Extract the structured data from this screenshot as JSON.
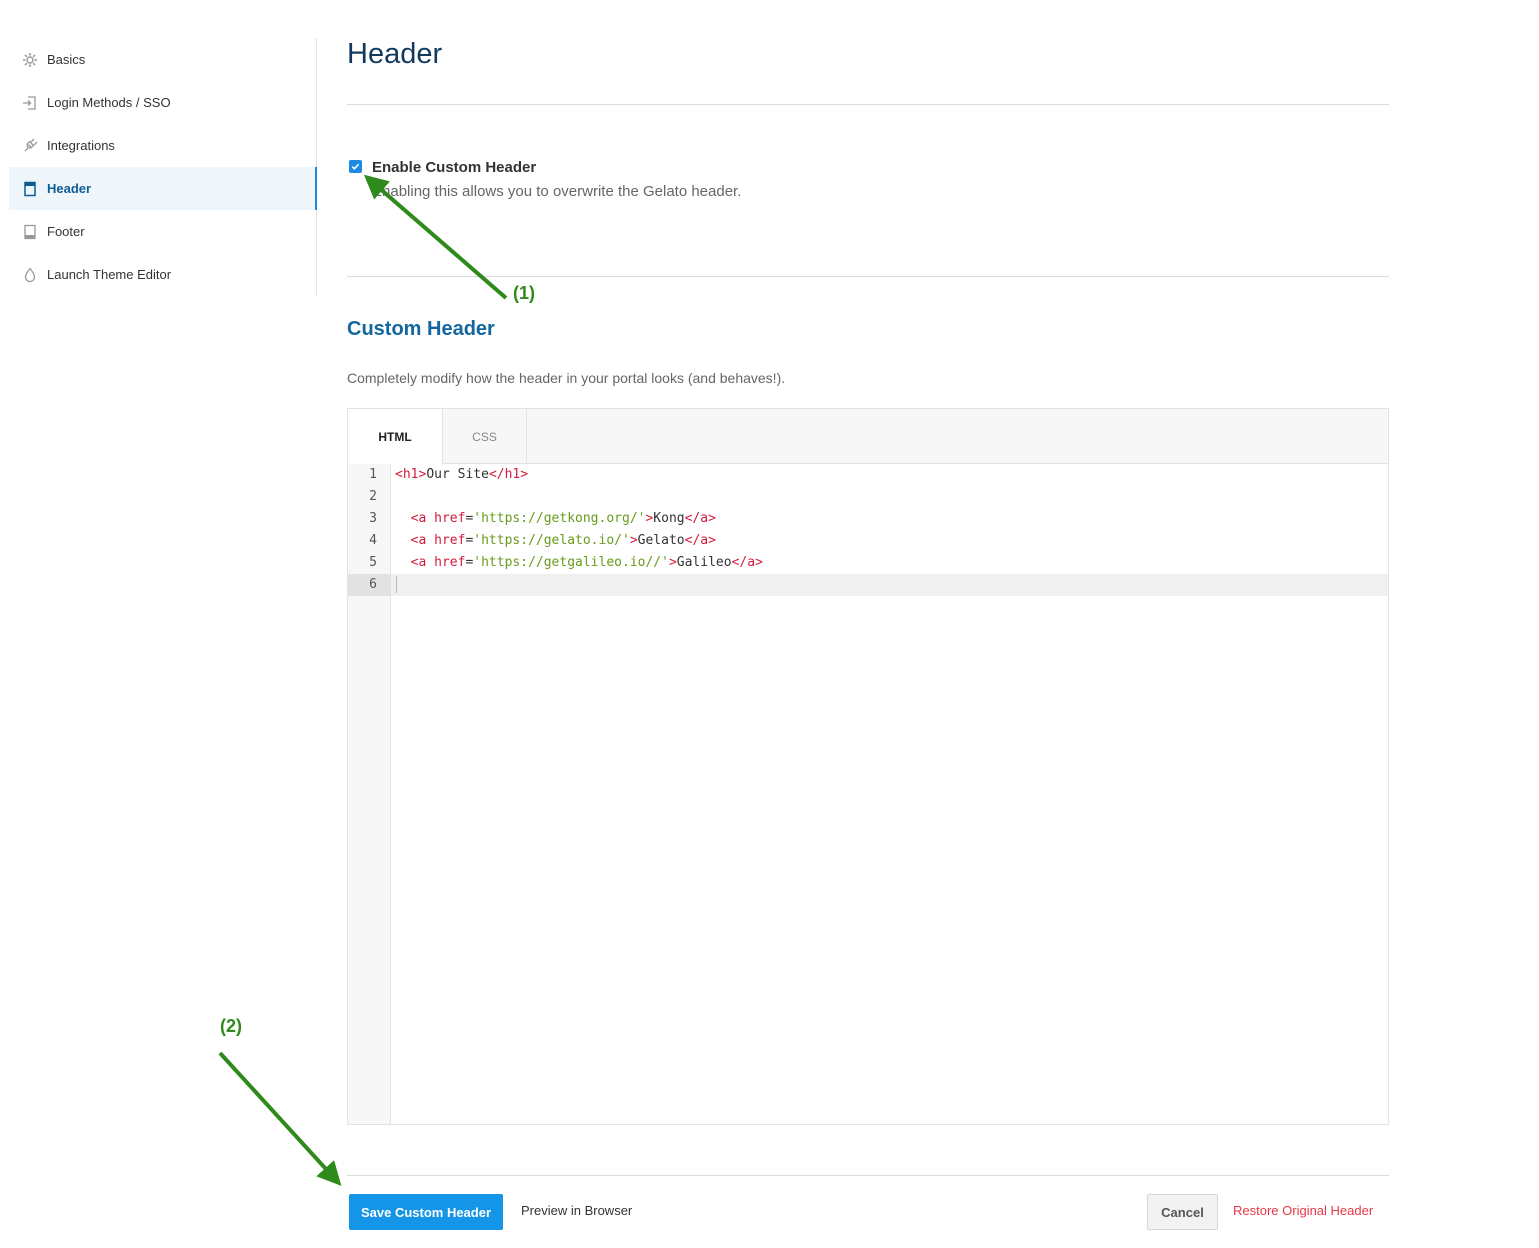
{
  "sidebar": {
    "items": [
      {
        "label": "Basics",
        "icon": "gear-icon"
      },
      {
        "label": "Login Methods / SSO",
        "icon": "login-icon"
      },
      {
        "label": "Integrations",
        "icon": "plug-icon"
      },
      {
        "label": "Header",
        "icon": "header-icon",
        "active": true
      },
      {
        "label": "Footer",
        "icon": "footer-icon"
      },
      {
        "label": "Launch Theme Editor",
        "icon": "droplet-icon"
      }
    ]
  },
  "main": {
    "title": "Header",
    "enable": {
      "label": "Enable Custom Header",
      "description": "Enabling this allows you to overwrite the Gelato header.",
      "checked": true
    },
    "section": {
      "title": "Custom Header",
      "description": "Completely modify how the header in your portal looks (and behaves!)."
    },
    "editor": {
      "tabs": [
        "HTML",
        "CSS"
      ],
      "active_tab": "HTML",
      "line_numbers": [
        "1",
        "2",
        "3",
        "4",
        "5",
        "6"
      ],
      "active_line": 6,
      "lines": [
        "<h1>Our Site</h1>",
        "",
        "  <a href='https://getkong.org/'>Kong</a>",
        "  <a href='https://gelato.io/'>Gelato</a>",
        "  <a href='https://getgalileo.io//'>Galileo</a>",
        ""
      ]
    },
    "actions": {
      "save": "Save Custom Header",
      "preview": "Preview in Browser",
      "cancel": "Cancel",
      "restore": "Restore Original Header"
    }
  },
  "annotations": {
    "one": "(1)",
    "two": "(2)"
  },
  "colors": {
    "primary": "#1595e8",
    "title": "#133a5e",
    "section_title": "#14669e",
    "danger": "#e53946",
    "annotation": "#2f8a1c"
  }
}
